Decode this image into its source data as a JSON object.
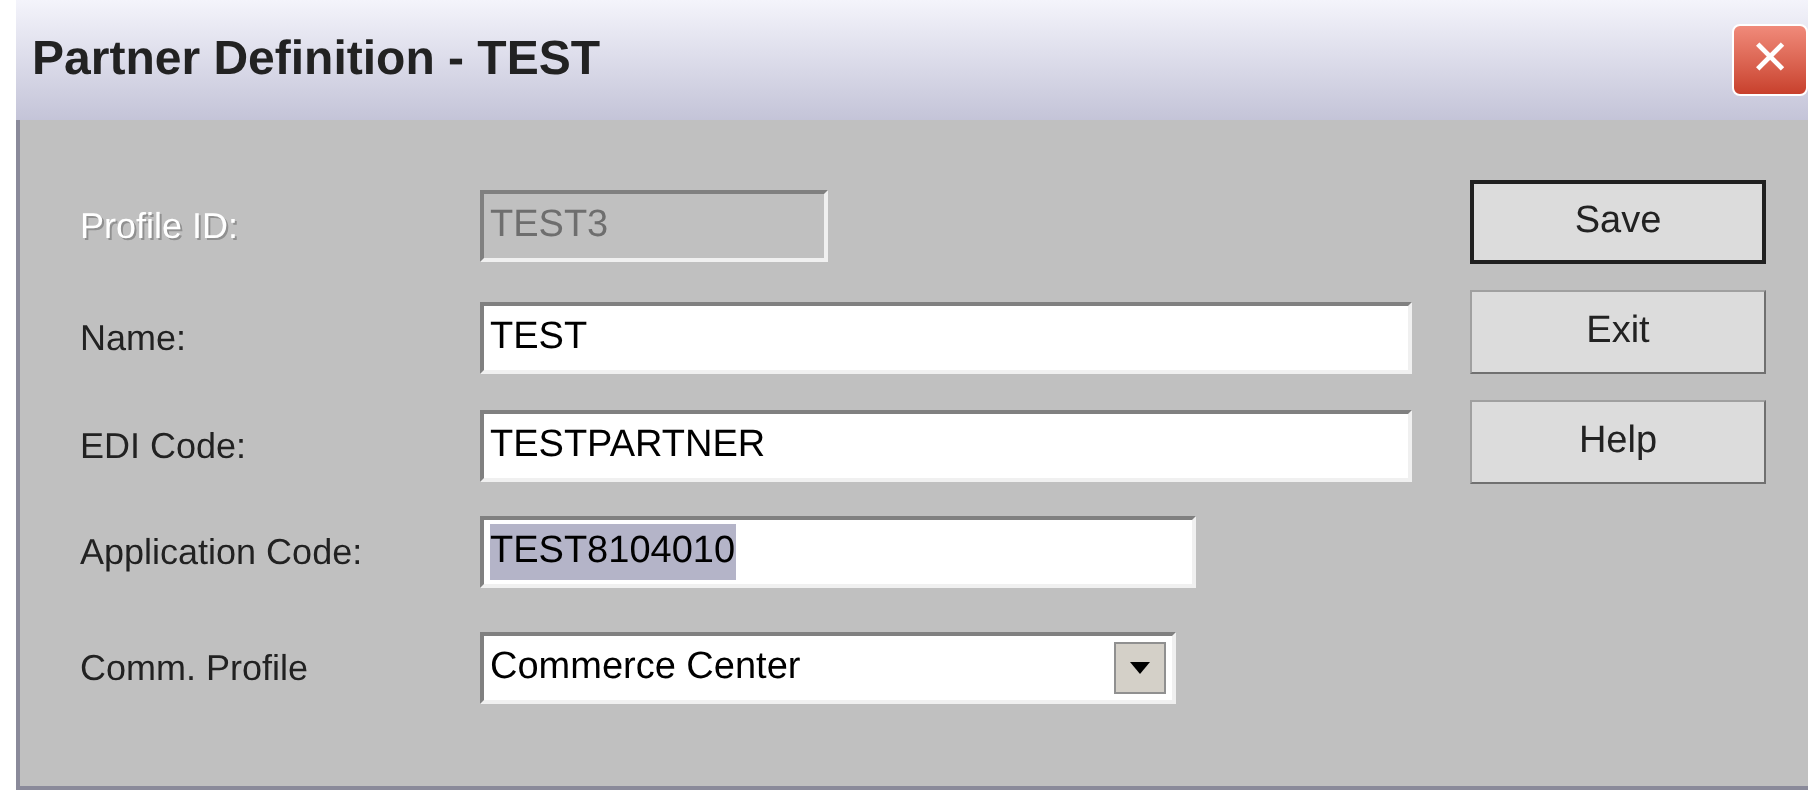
{
  "window": {
    "title": "Partner Definition - TEST",
    "close": "✕"
  },
  "fields": [
    {
      "kind": "text",
      "label": "Profile ID:",
      "value": "TEST3",
      "disabled": true,
      "selected": false
    },
    {
      "kind": "text",
      "label": "Name:",
      "value": "TEST",
      "disabled": false,
      "selected": false
    },
    {
      "kind": "text",
      "label": "EDI Code:",
      "value": "TESTPARTNER",
      "disabled": false,
      "selected": false
    },
    {
      "kind": "text",
      "label": "Application Code:",
      "value": "TEST8104010",
      "disabled": false,
      "selected": true
    },
    {
      "kind": "combo",
      "label": "Comm. Profile",
      "value": "Commerce Center",
      "disabled": false,
      "selected": false
    }
  ],
  "buttons": [
    {
      "label": "Save",
      "default": true
    },
    {
      "label": "Exit",
      "default": false
    },
    {
      "label": "Help",
      "default": false
    }
  ]
}
